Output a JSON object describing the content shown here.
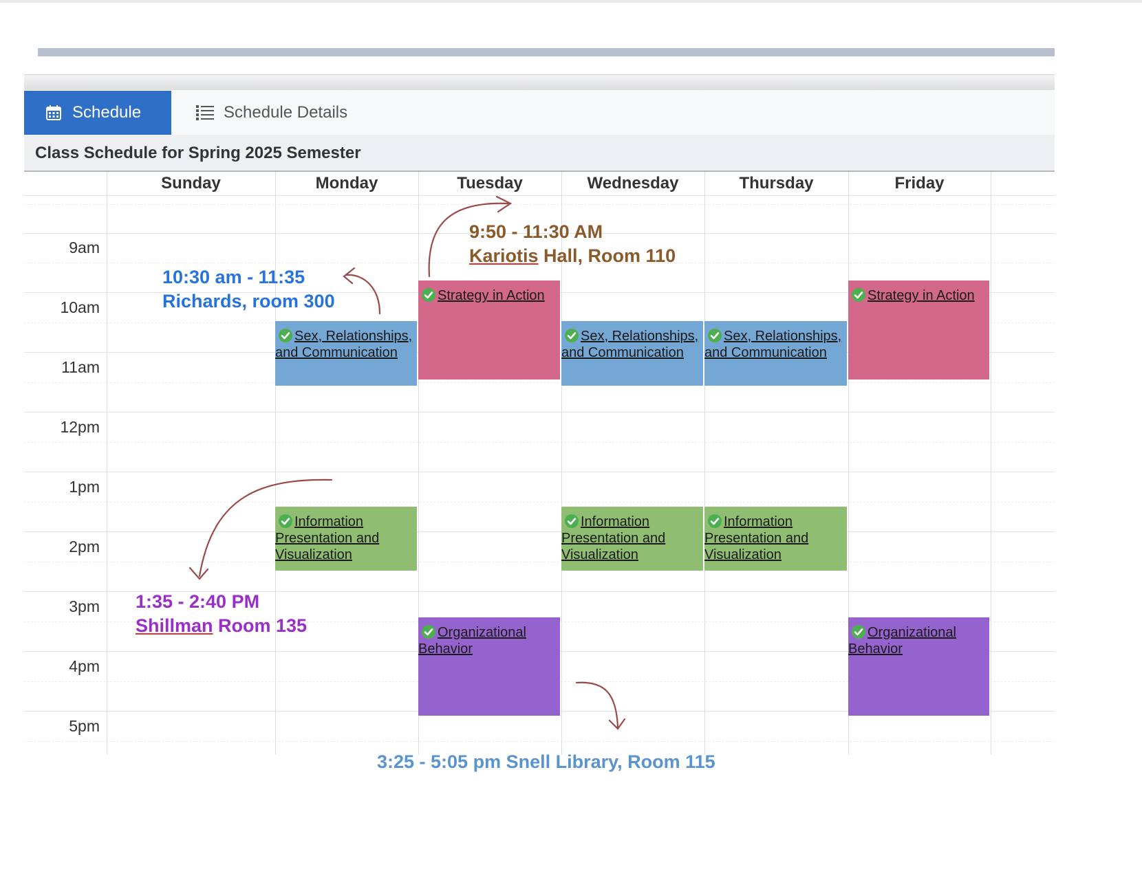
{
  "tabs": [
    {
      "label": "Schedule",
      "icon": "calendar-icon",
      "active": true
    },
    {
      "label": "Schedule Details",
      "icon": "list-icon",
      "active": false
    }
  ],
  "title": "Class Schedule for Spring 2025 Semester",
  "days": [
    "Sunday",
    "Monday",
    "Tuesday",
    "Wednesday",
    "Thursday",
    "Friday"
  ],
  "times": [
    "9am",
    "10am",
    "11am",
    "12pm",
    "1pm",
    "2pm",
    "3pm",
    "4pm",
    "5pm"
  ],
  "events": {
    "strategy": "Strategy in Action",
    "sex": "Sex, Relationships, and Communication",
    "info": "Information Presentation and Visualization",
    "org": "Organizational Behavior"
  },
  "colors": {
    "accent": "#2f6fc8",
    "strategy": "#d4688a",
    "sex": "#75a7d4",
    "info": "#8fbd71",
    "org": "#9563cd",
    "check": "#4caf50",
    "annotation_arrow": "#9b4a4a"
  },
  "annotations": {
    "richards": {
      "line1": "10:30 am - 11:35",
      "line2": "Richards, room 300"
    },
    "kariotis": {
      "time": "9:50 - 11:30 AM",
      "place_underlined": "Kariotis",
      "place_rest": " Hall, Room 110"
    },
    "shillman": {
      "time": "1:35 - 2:40 PM",
      "place_underlined": "Shillman",
      "place_rest": " Room 135"
    },
    "snell": {
      "text": "3:25 - 5:05 pm Snell Library, Room 115"
    }
  }
}
